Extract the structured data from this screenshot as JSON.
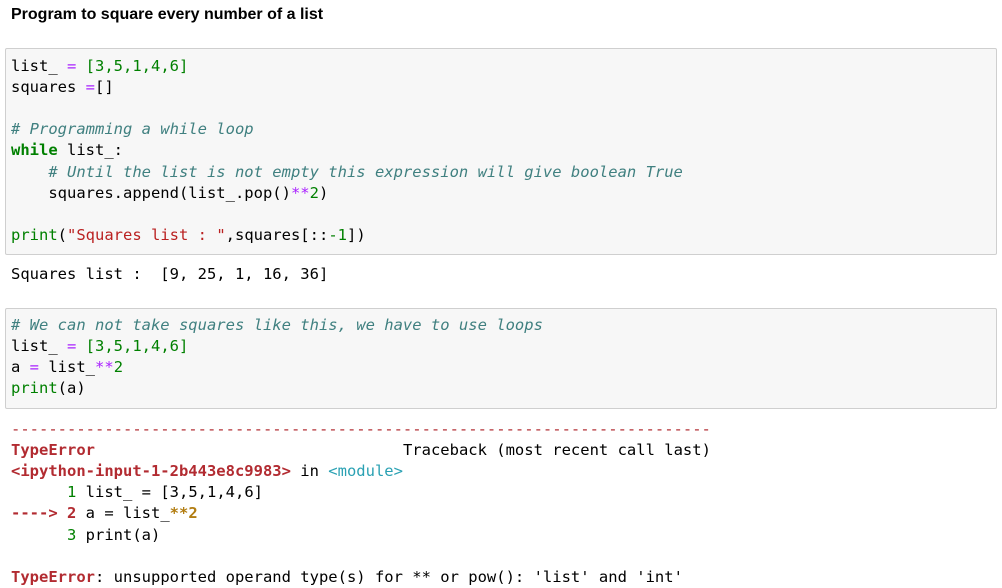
{
  "heading": "Program to square every number of a list",
  "cell1": {
    "lines": [
      [
        {
          "t": "list_ "
        },
        {
          "t": "=",
          "c": "op"
        },
        {
          "t": " [3,5,1,4,6]",
          "c": "num"
        }
      ],
      [
        {
          "t": "squares "
        },
        {
          "t": "=",
          "c": "op"
        },
        {
          "t": "[]"
        }
      ],
      [],
      [
        {
          "t": "# Programming a while loop",
          "c": "cm"
        }
      ],
      [
        {
          "t": "while",
          "c": "kw"
        },
        {
          "t": " list_:"
        }
      ],
      [
        {
          "t": "    "
        },
        {
          "t": "# Until the list is not empty this expression will give boolean True",
          "c": "cm"
        }
      ],
      [
        {
          "t": "    squares.append(list_.pop()"
        },
        {
          "t": "**",
          "c": "op"
        },
        {
          "t": "2",
          "c": "num"
        },
        {
          "t": ")"
        }
      ],
      [],
      [
        {
          "t": "print",
          "c": "bi"
        },
        {
          "t": "("
        },
        {
          "t": "\"Squares list : \"",
          "c": "str"
        },
        {
          "t": ",squares[::"
        },
        {
          "t": "-1",
          "c": "num"
        },
        {
          "t": "])"
        }
      ]
    ]
  },
  "output1": "Squares list :  [9, 25, 1, 16, 36]",
  "cell2": {
    "lines": [
      [
        {
          "t": "# We can not take squares like this, we have to use loops",
          "c": "cm"
        }
      ],
      [
        {
          "t": "list_ "
        },
        {
          "t": "=",
          "c": "op"
        },
        {
          "t": " [3,5,1,4,6]",
          "c": "num"
        }
      ],
      [
        {
          "t": "a "
        },
        {
          "t": "=",
          "c": "op"
        },
        {
          "t": " list_"
        },
        {
          "t": "**",
          "c": "op"
        },
        {
          "t": "2",
          "c": "num"
        }
      ],
      [
        {
          "t": "print",
          "c": "bi"
        },
        {
          "t": "(a)"
        }
      ]
    ]
  },
  "traceback": {
    "lines": [
      [
        {
          "t": "---------------------------------------------------------------------------",
          "c": "err"
        }
      ],
      [
        {
          "t": "TypeError",
          "c": "errb"
        },
        {
          "t": "                                 Traceback (most recent call last)"
        }
      ],
      [
        {
          "t": "<ipython-input-1-2b443e8c9983>",
          "c": "errb"
        },
        {
          "t": " in "
        },
        {
          "t": "<module>",
          "c": "mod"
        }
      ],
      [
        {
          "t": "      "
        },
        {
          "t": "1",
          "c": "lnum"
        },
        {
          "t": " list_ = [3,5,1,4,6]"
        }
      ],
      [
        {
          "t": "----> 2",
          "c": "arrow"
        },
        {
          "t": " a = list_"
        },
        {
          "t": "**2",
          "c": "emph"
        }
      ],
      [
        {
          "t": "      "
        },
        {
          "t": "3",
          "c": "lnum"
        },
        {
          "t": " print(a)"
        }
      ],
      [],
      [
        {
          "t": "TypeError",
          "c": "errb"
        },
        {
          "t": ": unsupported operand type(s) for ** or pow(): 'list' and 'int'"
        }
      ]
    ]
  }
}
